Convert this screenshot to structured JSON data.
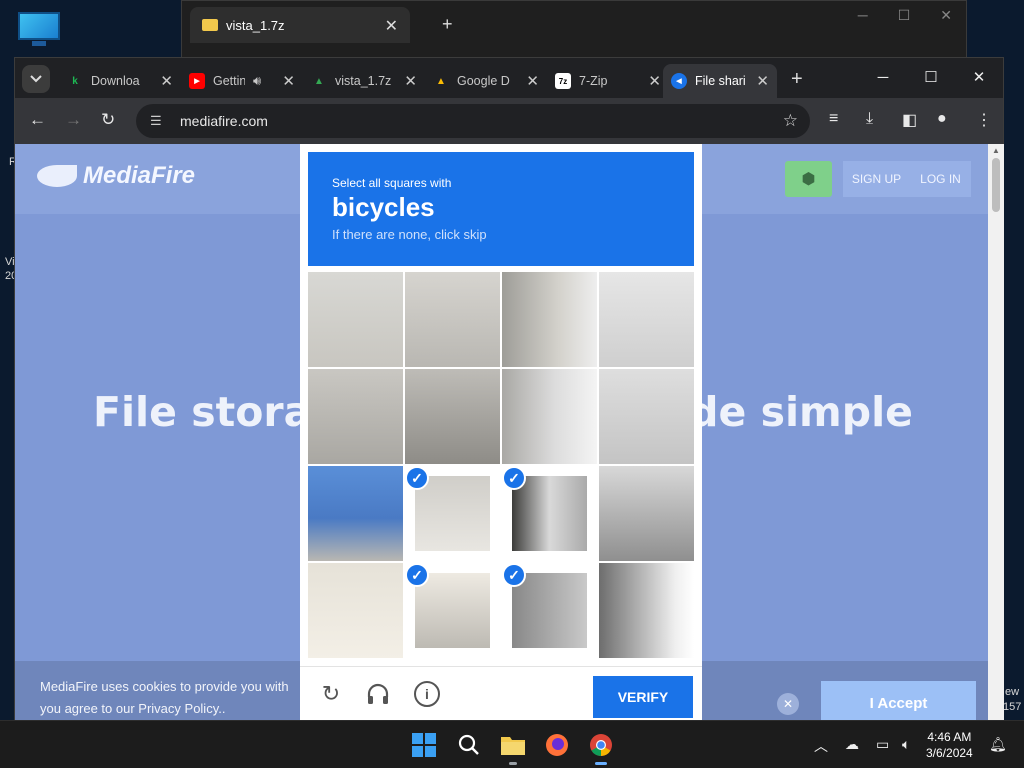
{
  "desktop": {
    "edge_left_1": "R",
    "edge_left_2": "Vi",
    "edge_left_3": "20",
    "edge_right_1": "ew",
    "edge_right_2": "157"
  },
  "back_window": {
    "tab_title": "vista_1.7z",
    "new_tab": "+"
  },
  "browser": {
    "tabs": [
      {
        "label": "Downloa",
        "favicon_text": "k",
        "favicon_color": "#1db954"
      },
      {
        "label": "Gettin",
        "favicon_text": "▶",
        "favicon_color": "#ff0000"
      },
      {
        "label": "vista_1.7z",
        "favicon_text": "▲",
        "favicon_color": "#34a853"
      },
      {
        "label": "Google D",
        "favicon_text": "▲",
        "favicon_color": "#fbbc04"
      },
      {
        "label": "7-Zip",
        "favicon_text": "7z",
        "favicon_color": "#ffffff"
      },
      {
        "label": "File shari",
        "favicon_text": "◀",
        "favicon_color": "#1a73e8"
      }
    ],
    "new_tab": "+",
    "url": "mediafire.com"
  },
  "page": {
    "logo_text": "MediaFire",
    "signup": "SIGN UP",
    "login": "LOG IN",
    "hero_left": "File storag",
    "hero_right": "de simple",
    "cookie_text": "MediaFire uses cookies to provide you with you agree to our Privacy Policy..",
    "accept": "I Accept"
  },
  "captcha": {
    "instruction": "Select all squares with",
    "target": "bicycles",
    "hint": "If there are none, click skip",
    "verify": "VERIFY",
    "selected_cells": [
      9,
      10,
      13,
      14
    ],
    "accent": "#1a73e8"
  },
  "taskbar": {
    "time": "4:46 AM",
    "date": "3/6/2024"
  }
}
